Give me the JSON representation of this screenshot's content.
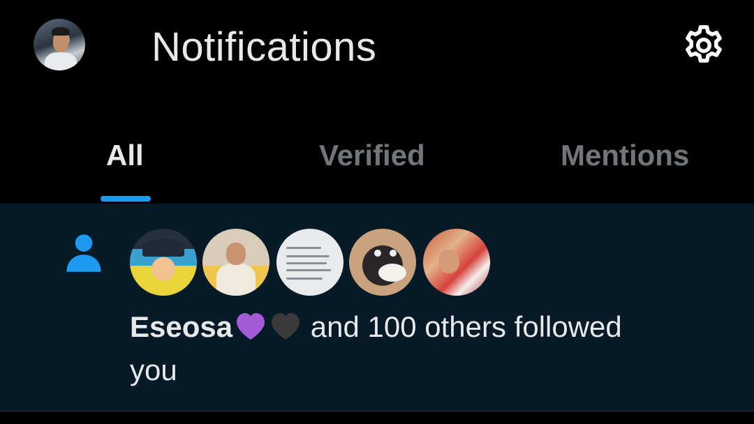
{
  "header": {
    "title": "Notifications",
    "settings_icon": "gear-icon"
  },
  "tabs": [
    {
      "label": "All",
      "active": true
    },
    {
      "label": "Verified",
      "active": false
    },
    {
      "label": "Mentions",
      "active": false
    }
  ],
  "notification": {
    "icon": "person-icon",
    "user_name": "Eseosa",
    "emoji": [
      "purple-heart",
      "black-heart"
    ],
    "text": " and 100 others followed",
    "text_line2": "you",
    "avatar_count": 5
  },
  "colors": {
    "accent": "#1d9bf0",
    "background": "#000000",
    "notification_bg": "#061a27",
    "muted_text": "#71767b",
    "purple_heart": "#a35cd6",
    "black_heart": "#3a3a3a"
  }
}
